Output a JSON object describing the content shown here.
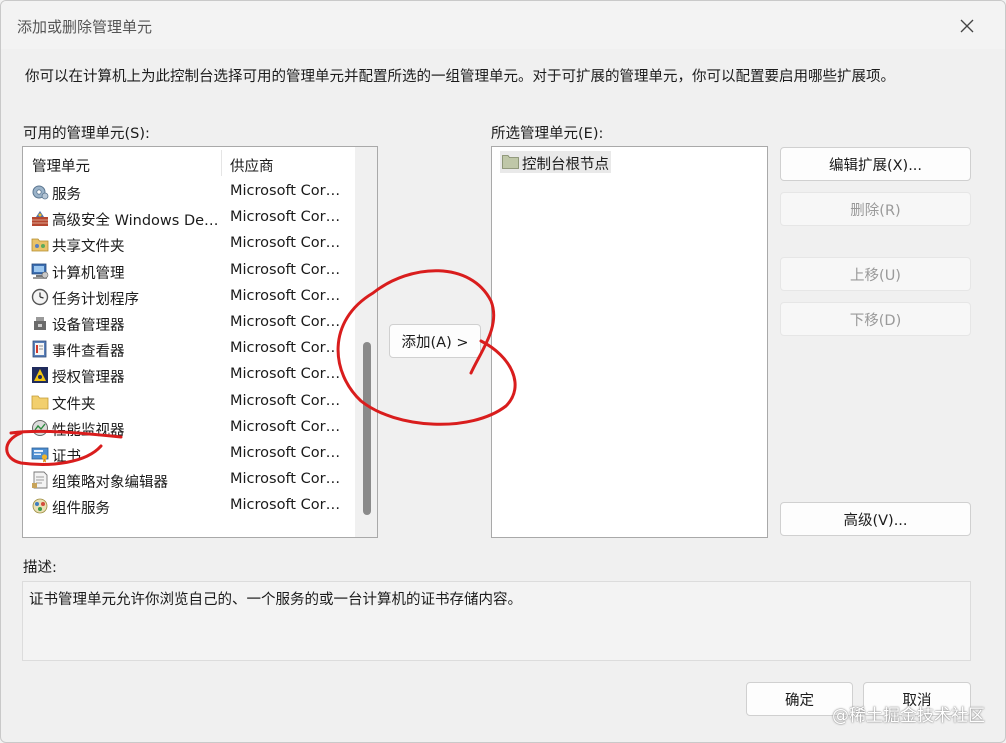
{
  "window": {
    "title": "添加或删除管理单元",
    "close_icon": "close-icon"
  },
  "instruction": "你可以在计算机上为此控制台选择可用的管理单元并配置所选的一组管理单元。对于可扩展的管理单元，你可以配置要启用哪些扩展项。",
  "available": {
    "label": "可用的管理单元(S):",
    "columns": [
      "管理单元",
      "供应商"
    ],
    "items": [
      {
        "name": "服务",
        "vendor": "Microsoft Corp...",
        "icon": "services-gear-icon"
      },
      {
        "name": "高级安全 Windows Def...",
        "vendor": "Microsoft Corp...",
        "icon": "firewall-icon"
      },
      {
        "name": "共享文件夹",
        "vendor": "Microsoft Corp...",
        "icon": "shared-folder-icon"
      },
      {
        "name": "计算机管理",
        "vendor": "Microsoft Corp...",
        "icon": "computer-management-icon"
      },
      {
        "name": "任务计划程序",
        "vendor": "Microsoft Corp...",
        "icon": "clock-icon"
      },
      {
        "name": "设备管理器",
        "vendor": "Microsoft Corp...",
        "icon": "device-manager-icon"
      },
      {
        "name": "事件查看器",
        "vendor": "Microsoft Corp...",
        "icon": "event-viewer-icon"
      },
      {
        "name": "授权管理器",
        "vendor": "Microsoft Corp...",
        "icon": "authorization-icon"
      },
      {
        "name": "文件夹",
        "vendor": "Microsoft Corp...",
        "icon": "folder-icon"
      },
      {
        "name": "性能监视器",
        "vendor": "Microsoft Corp...",
        "icon": "performance-icon"
      },
      {
        "name": "证书",
        "vendor": "Microsoft Corp...",
        "icon": "certificate-icon"
      },
      {
        "name": "组策略对象编辑器",
        "vendor": "Microsoft Corp...",
        "icon": "group-policy-icon"
      },
      {
        "name": "组件服务",
        "vendor": "Microsoft Corp...",
        "icon": "component-services-icon"
      }
    ]
  },
  "add_button": "添加(A) >",
  "selected": {
    "label": "所选管理单元(E):",
    "root_node": "控制台根节点",
    "root_icon": "folder-icon"
  },
  "buttons": {
    "edit_extensions": "编辑扩展(X)...",
    "remove": "删除(R)",
    "move_up": "上移(U)",
    "move_down": "下移(D)",
    "advanced": "高级(V)...",
    "ok": "确定",
    "cancel": "取消"
  },
  "description": {
    "label": "描述:",
    "text": "证书管理单元允许你浏览自己的、一个服务的或一台计算机的证书存储内容。"
  },
  "watermark": "@稀土掘金技术社区",
  "colors": {
    "annotation_red": "#d91d1d",
    "dialog_bg": "#f0f0f0"
  }
}
